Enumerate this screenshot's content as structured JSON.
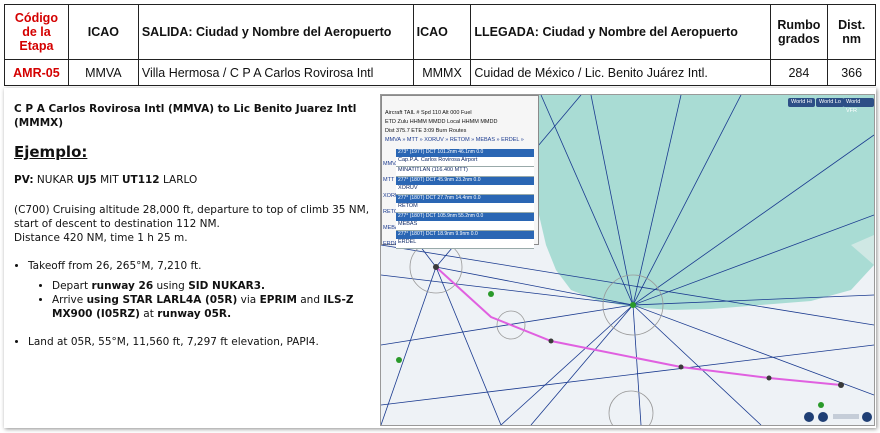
{
  "table": {
    "headers": {
      "code": "Código de la Etapa",
      "icao_dep": "ICAO",
      "departure": "SALIDA: Ciudad y Nombre del Aeropuerto",
      "icao_arr": "ICAO",
      "arrival": "LLEGADA: Ciudad y Nombre del Aeropuerto",
      "heading": "Rumbo grados",
      "distance": "Dist. nm"
    },
    "row": {
      "code": "AMR-05",
      "icao_dep": "MMVA",
      "departure": "Villa Hermosa / C P A Carlos Rovirosa Intl",
      "icao_arr": "MMMX",
      "arrival": "Cuidad de México / Lic. Benito Juárez Intl.",
      "heading": "284",
      "distance": "366"
    }
  },
  "brief": {
    "route_title": "C P A Carlos Rovirosa Intl (MMVA) to Lic Benito Juarez Intl (MMMX)",
    "example_heading": "Ejemplo:",
    "pv_label": "PV:",
    "pv_1": "NUKAR",
    "pv_2": "UJ5",
    "pv_3": "MIT",
    "pv_4": "UT112",
    "pv_5": "LARLO",
    "desc_1": "(C700) Cruising altitude 28,000 ft, departure to top of climb 35 NM,",
    "desc_2": "start of descent to destination 112 NM.",
    "desc_3": "Distance 420 NM, time 1 h 25 m.",
    "takeoff": "Takeoff from 26, 265°M, 7,210 ft.",
    "depart_1": "Depart",
    "depart_2": "runway 26",
    "depart_3": "using",
    "depart_4": "SID NUKAR3.",
    "arrive_1": "Arrive",
    "arrive_2": "using STAR LARL4A (05R)",
    "arrive_3": "via",
    "arrive_4": "EPRIM",
    "arrive_5": "and",
    "arrive_6": "ILS-Z MX900 (I05RZ)",
    "arrive_7": "at",
    "arrive_8": "runway 05R.",
    "land": "Land at 05R, 55°M, 11,560 ft, 7,297 ft elevation, PAPI4."
  },
  "map": {
    "panel": {
      "line1": "Aircraft  TAIL #   Spd  110   Alt  000   Fuel",
      "line2": "ETD  Zulu  HHMM  MMDD   Local  HHMM  MMDD",
      "line3": "Dist  375.7    ETE  3:09    Burn          Routes",
      "line4": "MMVA » MTT » XORUV » RETOM » MEBAS » ERDEL »",
      "waypoints": [
        "Cap.P.A. Carlos Rovirosa Airport",
        "MINATITLAN (116.400 MTT)",
        "XORUV",
        "RETOM",
        "MEBAS",
        "ERDEL"
      ],
      "segments": [
        "273° (197T)   DCT   101.2nm   46.1nm   0.0",
        "277° (180T)   DCT   45.9nm   23.2nm   0.0",
        "277° (180T)   DCT   27.7nm   14.4nm   0.0",
        "277° (180T)   DCT   105.9nm   55.2nm   0.0",
        "277° (180T)   DCT   18.9nm   9.9nm   0.0"
      ],
      "side_labels": [
        "MMVA",
        "MTT",
        "XORUV",
        "RETOM",
        "MEBAS",
        "ERDEL"
      ]
    },
    "buttons": [
      "World Hi",
      "World Lo",
      "World VFR"
    ],
    "colors": {
      "land": "#eef2f6",
      "water": "#a9dcd4",
      "airway": "#1a3a8f",
      "route": "#e060e0",
      "accent": "#d40000"
    }
  }
}
